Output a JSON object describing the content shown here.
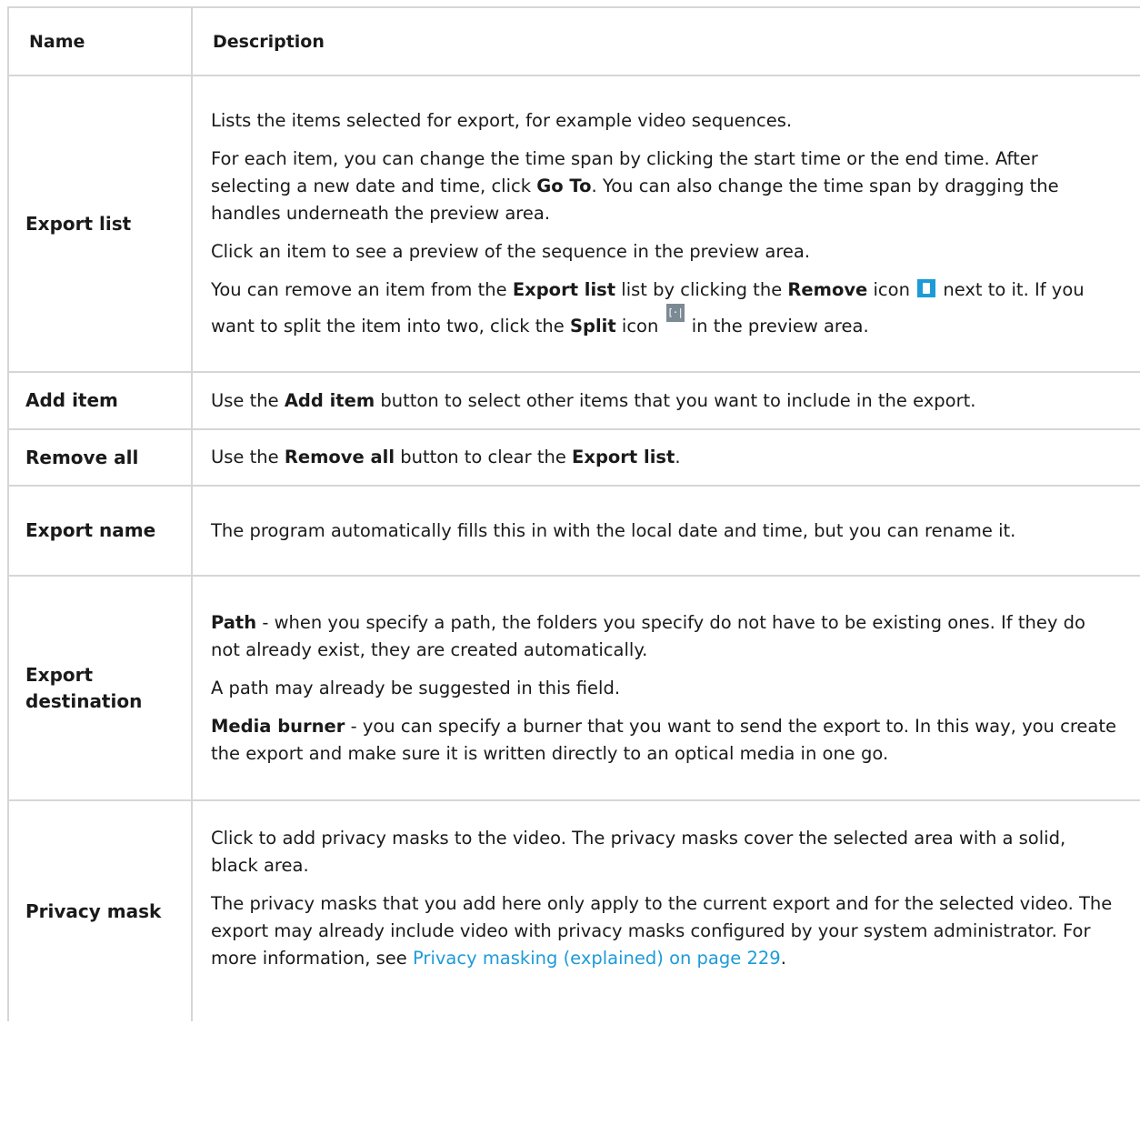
{
  "table": {
    "headers": {
      "name": "Name",
      "description": "Description"
    },
    "rows": {
      "export_list": {
        "name": "Export list",
        "p1": "Lists the items selected for export, for example video sequences.",
        "p2_a": "For each item, you can change the time span by clicking the start time or the end time. After selecting a new date and time, click ",
        "p2_b": "Go To",
        "p2_c": ". You can also change the time span by dragging the handles underneath the preview area.",
        "p3": "Click an item to see a preview of the sequence in the preview area.",
        "p4_a": "You can remove an item from the ",
        "p4_b": "Export list",
        "p4_c": " list by clicking the ",
        "p4_d": "Remove",
        "p4_e": " icon",
        "p4_f": " next to it. If you want to split the item into two, click the ",
        "p4_g": "Split",
        "p4_h": " icon",
        "p4_i": " in the preview area.",
        "split_icon_glyph": "[·|·]"
      },
      "add_item": {
        "name": "Add item",
        "a": "Use the ",
        "b": "Add item",
        "c": " button to select other items that you want to include in the export."
      },
      "remove_all": {
        "name": "Remove all",
        "a": "Use the ",
        "b": "Remove all",
        "c": " button to clear the ",
        "d": "Export list",
        "e": "."
      },
      "export_name": {
        "name": "Export name",
        "desc": "The program automatically fills this in with the local date and time, but you can rename it."
      },
      "export_destination": {
        "name": "Export destination",
        "p1_a": "Path",
        "p1_b": " - when you specify a path, the folders you specify do not have to be existing ones. If they do not already exist, they are created automatically.",
        "p2": "A path may already be suggested in this field.",
        "p3_a": "Media burner",
        "p3_b": " - you can specify a burner that you want to send the export to. In this way, you create the export and make sure it is written directly to an optical media in one go."
      },
      "privacy_mask": {
        "name": "Privacy mask",
        "p1": "Click to add privacy masks to the video. The privacy masks cover the selected area with a solid, black area.",
        "p2_a": "The privacy masks that you add here only apply to the current export and for the selected video. The export may already include video with privacy masks configured by your system administrator. For more information, see ",
        "p2_link": "Privacy masking (explained) on page 229",
        "p2_c": "."
      }
    }
  },
  "colors": {
    "link": "#1d9bd8",
    "border": "#d6d6d6",
    "remove_icon": "#1d9bd8",
    "split_icon": "#7c8a94"
  }
}
